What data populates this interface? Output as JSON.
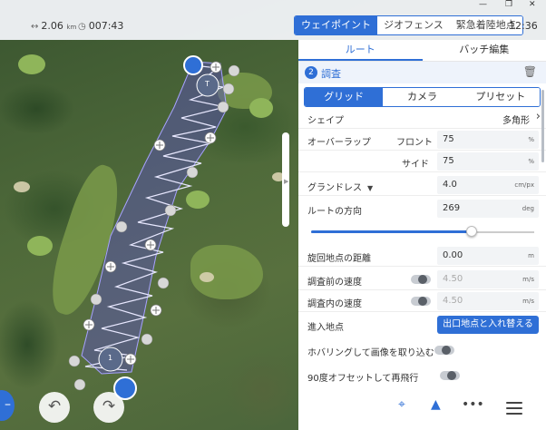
{
  "window": {
    "min": "—",
    "restore": "❐",
    "close": "✕"
  },
  "stats": {
    "distance_icon": "↔",
    "distance": "2.06",
    "distance_unit": "km",
    "time_icon": "◷",
    "time": "007:43"
  },
  "mode_tabs": [
    "ウェイポイント",
    "ジオフェンス",
    "緊急着陸地点"
  ],
  "active_mode": 0,
  "clock": "12:36",
  "panel_tabs": [
    "ルート",
    "バッチ編集"
  ],
  "survey": {
    "number": "2",
    "title": "調査"
  },
  "sub_tabs": [
    "グリッド",
    "カメラ",
    "プリセット"
  ],
  "fields": {
    "shape_label": "シェイプ",
    "shape_value": "多角形",
    "overlap_label": "オーバーラップ",
    "front_label": "フロント",
    "front_value": "75",
    "side_label": "サイド",
    "side_value": "75",
    "pct": "%",
    "gsd_label": "グランドレス",
    "gsd_value": "4.0",
    "gsd_unit": "cm/px",
    "direction_label": "ルートの方向",
    "direction_value": "269",
    "direction_unit": "deg",
    "direction_slider_fraction": 0.72,
    "turn_label": "旋回地点の距離",
    "turn_value": "0.00",
    "turn_unit": "m",
    "pre_speed_label": "調査前の速度",
    "pre_speed_value": "4.50",
    "in_speed_label": "調査内の速度",
    "in_speed_value": "4.50",
    "speed_unit": "m/s",
    "entry_label": "進入地点",
    "entry_button": "出口地点と入れ替える",
    "hover_label": "ホバリングして画像を取り込む",
    "reflight_label": "90度オフセットして再飛行"
  },
  "map_labels": {
    "takeoff": "T",
    "start": "1"
  },
  "colors": {
    "accent": "#2f6fd6",
    "survey_fill": "#5b4fc2"
  }
}
